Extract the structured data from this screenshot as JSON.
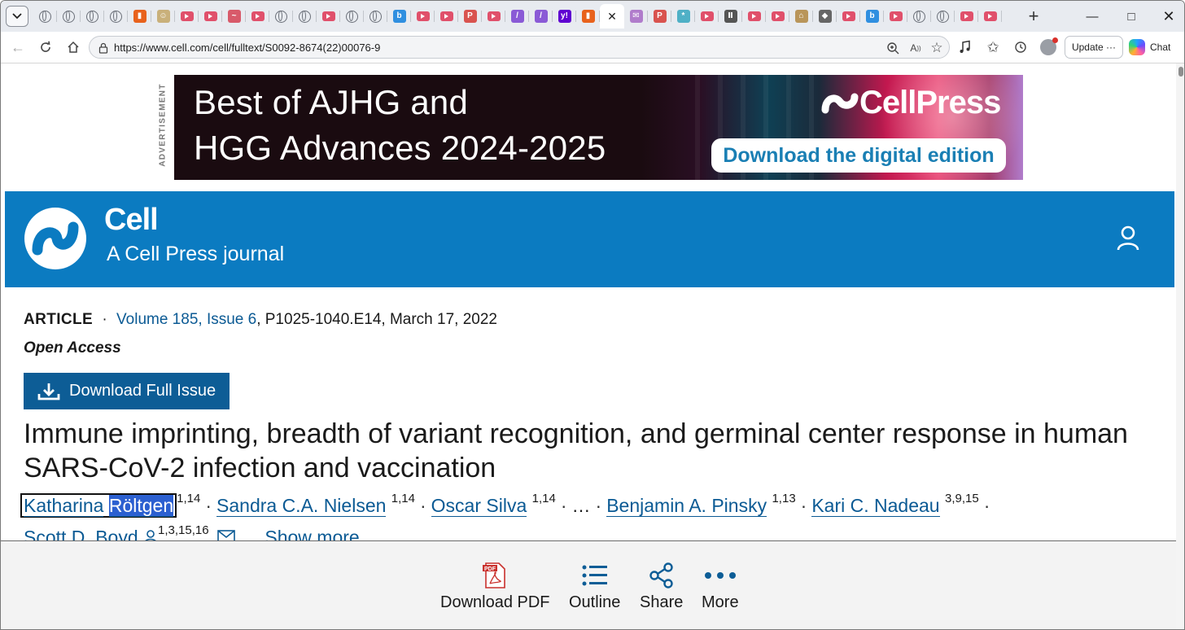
{
  "browser": {
    "url": "https://www.cell.com/cell/fulltext/S0092-8674(22)00076-9",
    "update_label": "Update",
    "update_more": "···",
    "chat_label": "Chat",
    "tabs": [
      {
        "icon": "globe-icon"
      },
      {
        "icon": "globe-icon"
      },
      {
        "icon": "globe-icon"
      },
      {
        "icon": "globe-icon"
      },
      {
        "icon": "bookmark-orange-icon",
        "color": "#e8621c"
      },
      {
        "icon": "figure-icon",
        "color": "#c9b07a"
      },
      {
        "icon": "youtube-icon"
      },
      {
        "icon": "youtube-icon"
      },
      {
        "icon": "wave-icon",
        "color": "#d85a6a"
      },
      {
        "icon": "youtube-icon"
      },
      {
        "icon": "globe-icon"
      },
      {
        "icon": "globe-icon"
      },
      {
        "icon": "youtube-icon"
      },
      {
        "icon": "globe-icon"
      },
      {
        "icon": "globe-icon"
      },
      {
        "icon": "bing-icon",
        "color": "#2f8fe0"
      },
      {
        "icon": "youtube-icon"
      },
      {
        "icon": "youtube-icon"
      },
      {
        "icon": "pdf-icon",
        "color": "#d9534f"
      },
      {
        "icon": "youtube-icon"
      },
      {
        "icon": "slash-icon",
        "color": "#8a5ad6"
      },
      {
        "icon": "slash-icon",
        "color": "#8a5ad6"
      },
      {
        "icon": "yahoo-icon",
        "color": "#5f01d1"
      },
      {
        "icon": "bookmark-orange-icon",
        "color": "#e8621c"
      },
      {
        "icon": "close-icon",
        "active": true
      },
      {
        "icon": "mail-icon",
        "color": "#b07ccb"
      },
      {
        "icon": "pdf-icon",
        "color": "#d9534f"
      },
      {
        "icon": "snowflake-icon",
        "color": "#4fb0c6"
      },
      {
        "icon": "youtube-icon"
      },
      {
        "icon": "books-icon",
        "color": "#555"
      },
      {
        "icon": "youtube-icon"
      },
      {
        "icon": "youtube-icon"
      },
      {
        "icon": "house-icon",
        "color": "#b9955a"
      },
      {
        "icon": "diamond-icon",
        "color": "#666"
      },
      {
        "icon": "youtube-icon"
      },
      {
        "icon": "bing-icon",
        "color": "#2f8fe0"
      },
      {
        "icon": "youtube-icon"
      },
      {
        "icon": "globe-icon"
      },
      {
        "icon": "globe-icon"
      },
      {
        "icon": "youtube-icon"
      },
      {
        "icon": "youtube-icon"
      }
    ]
  },
  "ad": {
    "label": "ADVERTISEMENT",
    "headline_1": "Best of AJHG and",
    "headline_2": "HGG Advances 2024-2025",
    "brand": "CellPress",
    "cta": "Download the digital edition"
  },
  "journal": {
    "name": "Cell",
    "subtitle": "A Cell Press journal",
    "color": "#0b7bc1"
  },
  "article": {
    "type": "ARTICLE",
    "separator": "·",
    "volume_issue": "Volume 185, Issue 6",
    "pages_date": ", P1025-1040.E14, March 17, 2022",
    "access": "Open Access",
    "download_issue_label": "Download Full Issue",
    "title": "Immune imprinting, breadth of variant recognition, and germinal center response in human SARS-CoV-2 infection and vaccination",
    "authors": [
      {
        "first": "Katharina",
        "last": "Röltgen",
        "aff": "1,14"
      },
      {
        "name": "Sandra C.A. Nielsen",
        "aff": "1,14"
      },
      {
        "name": "Oscar Silva",
        "aff": "1,14"
      },
      {
        "ellipsis": "…"
      },
      {
        "name": "Benjamin A. Pinsky",
        "aff": "1,13"
      },
      {
        "name": "Kari C. Nadeau",
        "aff": "3,9,15"
      },
      {
        "name": "Scott D. Boyd",
        "aff": "1,3,15,16"
      }
    ],
    "show_more": "Show more"
  },
  "bottom_bar": {
    "download_pdf": "Download PDF",
    "pdf_badge": "PDF",
    "outline": "Outline",
    "share": "Share",
    "more": "More"
  }
}
